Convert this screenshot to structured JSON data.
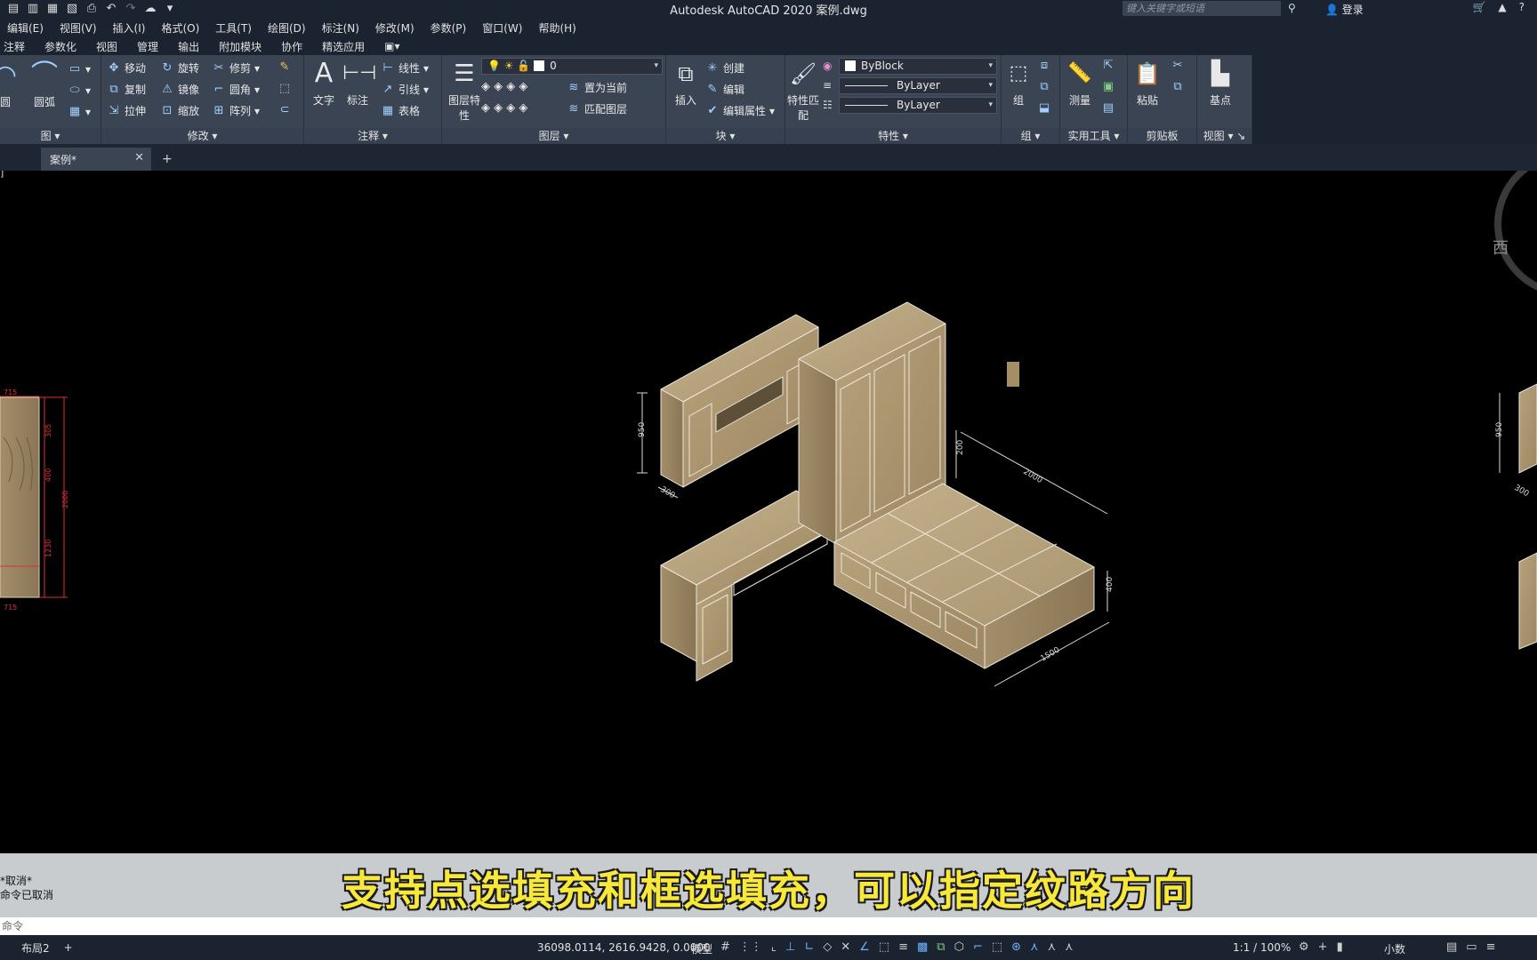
{
  "app": {
    "title": "Autodesk AutoCAD 2020    案例.dwg",
    "search_placeholder": "键入关键字或短语",
    "login": "登录"
  },
  "menu": [
    "编辑(E)",
    "视图(V)",
    "插入(I)",
    "格式(O)",
    "工具(T)",
    "绘图(D)",
    "标注(N)",
    "修改(M)",
    "参数(P)",
    "窗口(W)",
    "帮助(H)"
  ],
  "ribbon_tabs": [
    "注释",
    "参数化",
    "视图",
    "管理",
    "输出",
    "附加模块",
    "协作",
    "精选应用"
  ],
  "ribbon": {
    "draw": {
      "title": "图",
      "arc": "圆弧",
      "circle": "圆"
    },
    "modify": {
      "title": "修改",
      "move": "移动",
      "rotate": "旋转",
      "trim": "修剪",
      "copy": "复制",
      "mirror": "镜像",
      "fillet": "圆角",
      "stretch": "拉伸",
      "scale": "缩放",
      "array": "阵列"
    },
    "annotation": {
      "title": "注释",
      "text": "文字",
      "dimension": "标注",
      "linear": "线性",
      "leader": "引线",
      "table": "表格"
    },
    "layers": {
      "title": "图层",
      "layer_props": "图层特性",
      "current_layer": "0",
      "set_current": "置为当前",
      "match_layer": "匹配图层"
    },
    "block": {
      "title": "块",
      "insert": "插入",
      "create": "创建",
      "edit": "编辑",
      "edit_attr": "编辑属性"
    },
    "properties": {
      "title": "特性",
      "match": "特性匹配",
      "color": "ByBlock",
      "linetype": "ByLayer",
      "lineweight": "ByLayer"
    },
    "groups": {
      "title": "组",
      "group": "组"
    },
    "utilities": {
      "title": "实用工具",
      "measure": "测量"
    },
    "clipboard": {
      "title": "剪贴板",
      "paste": "粘贴"
    },
    "view": {
      "title": "视图",
      "base": "基点"
    }
  },
  "doc_tab": {
    "name": "案例*"
  },
  "canvas": {
    "viewcube": "西",
    "dims": {
      "d950": "950",
      "d300": "300",
      "d200": "200",
      "d2000": "2000",
      "d400": "400",
      "d1500": "1500"
    },
    "left_dims": {
      "top": "715",
      "a": "305",
      "b": "400",
      "c": "2000",
      "d": "1230",
      "e": "40",
      "bottom": "715"
    }
  },
  "command": {
    "history1": "*取消*",
    "history2": "命令已取消",
    "prompt": "命令"
  },
  "subtitle": "支持点选填充和框选填充，可以指定纹路方向",
  "status": {
    "layout_tab": "布局2",
    "coords": "36098.0114, 2616.9428, 0.0000",
    "model": "模型",
    "scale": "1:1 / 100%",
    "units": "小数"
  }
}
